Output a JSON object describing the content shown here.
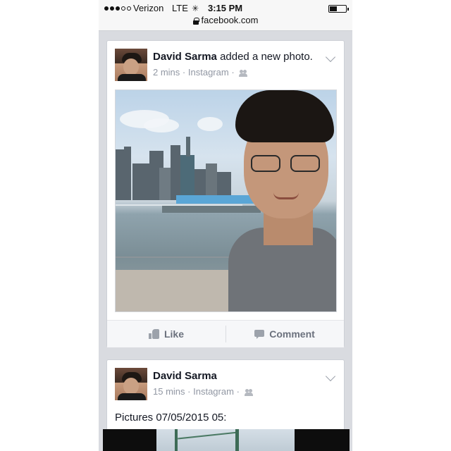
{
  "status_bar": {
    "carrier": "Verizon",
    "network": "LTE",
    "time": "3:15 PM",
    "signal_bars_filled": 3,
    "signal_bars_total": 5,
    "battery_level": 0.45
  },
  "address_bar": {
    "url": "facebook.com",
    "lock_icon": "lock-icon"
  },
  "posts": [
    {
      "author": "David Sarma",
      "action_text": "added a new photo.",
      "time": "2 mins",
      "separator": "·",
      "source": "Instagram",
      "audience_icon": "friends-icon",
      "actions": {
        "like_label": "Like",
        "comment_label": "Comment",
        "like_icon": "thumbs-up-icon",
        "comment_icon": "comment-bubble-icon"
      }
    },
    {
      "author": "David Sarma",
      "time": "15 mins",
      "separator": "·",
      "source": "Instagram",
      "audience_icon": "friends-icon",
      "caption": "Pictures 07/05/2015 05:"
    }
  ],
  "colors": {
    "facebook_text": "#141823",
    "meta_gray": "#9197a3",
    "feed_background": "#d9dbe0"
  }
}
